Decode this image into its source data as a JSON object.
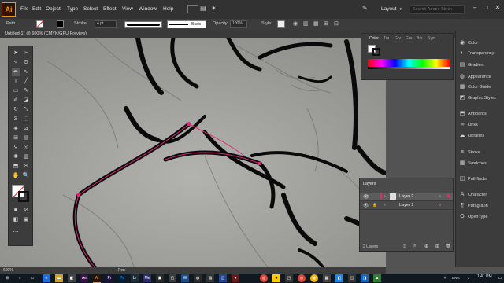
{
  "menubar": {
    "logo": "Ai",
    "items": [
      "File",
      "Edit",
      "Object",
      "Type",
      "Select",
      "Effect",
      "View",
      "Window",
      "Help"
    ],
    "workspace": "Layout",
    "search_placeholder": "Search Adobe Stock"
  },
  "controlbar": {
    "selection_label": "Path",
    "stroke_label": "Stroke:",
    "stroke_value": "4 pt",
    "brush_label": "Basic",
    "opacity_label": "Opacity:",
    "opacity_value": "100%",
    "style_label": "Style:"
  },
  "document": {
    "tab_title": "Untitled-1* @ 600% (CMYK/GPU Preview)"
  },
  "status": {
    "zoom": "600%",
    "tool": "Pen"
  },
  "color_panel": {
    "tabs": [
      "Color",
      "Tra",
      "Grv",
      "Gra",
      "Brs",
      "Sym"
    ]
  },
  "right_dock": {
    "items": [
      {
        "label": "Color",
        "icon": "color-icon"
      },
      {
        "label": "Transparency",
        "icon": "transparency-icon"
      },
      {
        "label": "Gradient",
        "icon": "gradient-icon"
      },
      {
        "label": "Appearance",
        "icon": "appearance-icon"
      },
      {
        "label": "Color Guide",
        "icon": "color-guide-icon"
      },
      {
        "label": "Graphic Styles",
        "icon": "graphic-styles-icon"
      },
      {
        "label": "Artboards",
        "icon": "artboards-icon"
      },
      {
        "label": "Links",
        "icon": "links-icon"
      },
      {
        "label": "Libraries",
        "icon": "libraries-icon"
      },
      {
        "label": "Stroke",
        "icon": "stroke-icon"
      },
      {
        "label": "Swatches",
        "icon": "swatches-icon"
      },
      {
        "label": "Pathfinder",
        "icon": "pathfinder-icon"
      },
      {
        "label": "Character",
        "icon": "character-icon"
      },
      {
        "label": "Paragraph",
        "icon": "paragraph-icon"
      },
      {
        "label": "OpenType",
        "icon": "opentype-icon"
      }
    ]
  },
  "layers_panel": {
    "title": "Layers",
    "layers": [
      {
        "name": "Layer 2",
        "selected": true
      },
      {
        "name": "Layer 1",
        "selected": false
      }
    ],
    "count": "2 Layers"
  },
  "taskbar": {
    "time": "1:41 PM",
    "lang": "ENG"
  },
  "colors": {
    "accent": "#f7931e",
    "path_highlight": "#e0257a",
    "layer_color": "#d1306b"
  }
}
